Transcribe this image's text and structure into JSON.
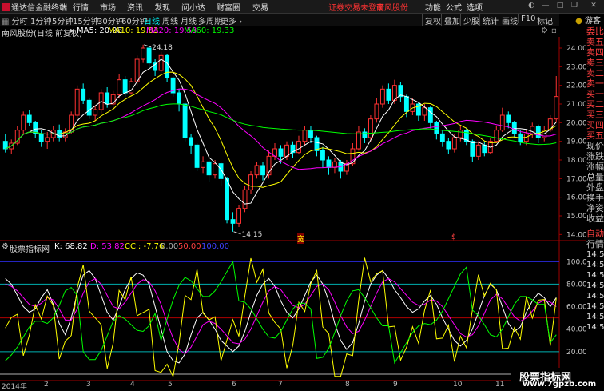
{
  "app": {
    "title": "通达信金融终端"
  },
  "menu": [
    "行情",
    "市场",
    "资讯",
    "发现",
    "问小达",
    "财富圈",
    "交易"
  ],
  "warning": "证券交易未登录",
  "stock_link": "南风股份",
  "right_menu": [
    "功能",
    "公式",
    "选项"
  ],
  "periods": [
    "分时",
    "1分钟",
    "5分钟",
    "15分钟",
    "30分钟",
    "60分钟",
    "日线",
    "周线",
    "月线",
    "多周期",
    "更多"
  ],
  "active_period": "日线",
  "right_tools": [
    "复权",
    "叠加",
    "少股",
    "统计",
    "画线",
    "F10",
    "标记"
  ],
  "guest": "游客",
  "info": {
    "stock": "南风股份(日线 前复权)",
    "ma5": "MA5: 20.28",
    "ma10": "MA10: 19.83",
    "ma20": "MA20: 19.53",
    "ma60": "MA60: 19.33"
  },
  "price_axis": [
    "24.00",
    "23.00",
    "22.00",
    "21.00",
    "20.00",
    "19.00",
    "18.00",
    "17.00",
    "16.00",
    "15.00",
    "14.00"
  ],
  "high_label": "24.18",
  "low_label": "14.15",
  "indicator": {
    "name": "股票指标网",
    "k": "K: 68.82",
    "d": "D: 53.82",
    "cci": "CCI: -7.76",
    "v0": "0.00",
    "v50": "50.00",
    "v100": "100.00"
  },
  "ind_axis": [
    "100.00",
    "80.00",
    "60.00",
    "40.00",
    "20.00"
  ],
  "markers": [
    "宽",
    "$"
  ],
  "dates": [
    "2014年",
    "2",
    "3",
    "4",
    "5",
    "6",
    "7",
    "8",
    "9",
    "10",
    "11"
  ],
  "side_labels": [
    {
      "t": "委比",
      "c": "red"
    },
    {
      "t": "卖五",
      "c": "red"
    },
    {
      "t": "卖四",
      "c": "red"
    },
    {
      "t": "卖三",
      "c": "red"
    },
    {
      "t": "卖二",
      "c": "red"
    },
    {
      "t": "卖一",
      "c": "red"
    },
    {
      "t": "买一",
      "c": "red"
    },
    {
      "t": "买二",
      "c": "red"
    },
    {
      "t": "买三",
      "c": "red"
    },
    {
      "t": "买四",
      "c": "red"
    },
    {
      "t": "买五",
      "c": "red"
    },
    {
      "t": "现价",
      "c": ""
    },
    {
      "t": "涨跌",
      "c": ""
    },
    {
      "t": "涨幅",
      "c": ""
    },
    {
      "t": "总量",
      "c": ""
    },
    {
      "t": "外盘",
      "c": ""
    },
    {
      "t": "换手",
      "c": ""
    },
    {
      "t": "净资",
      "c": ""
    },
    {
      "t": "收益",
      "c": ""
    }
  ],
  "side_bottom": [
    "自动",
    "行情"
  ],
  "side_times": [
    "14:56",
    "14:56",
    "14:56",
    "14:56",
    "14:56",
    "14:56",
    "14:56",
    "14:56"
  ],
  "watermark": {
    "line1": "股票指标网",
    "line2": "www.7gpzb.com"
  },
  "colors": {
    "up": "#ff3232",
    "down": "#00ffff",
    "ma5": "#ffffff",
    "ma10": "#ffff00",
    "ma20": "#ff00ff",
    "ma60": "#00ff00"
  },
  "chart_data": {
    "type": "line",
    "candles": [
      [
        19.0,
        18.6,
        19.4,
        18.4
      ],
      [
        18.6,
        18.9,
        19.1,
        18.3
      ],
      [
        18.9,
        19.6,
        19.8,
        18.8
      ],
      [
        19.6,
        20.4,
        20.6,
        19.4
      ],
      [
        20.4,
        20.0,
        20.7,
        19.8
      ],
      [
        20.0,
        19.4,
        20.1,
        19.2
      ],
      [
        19.4,
        19.0,
        19.6,
        18.7
      ],
      [
        19.0,
        19.2,
        19.5,
        18.6
      ],
      [
        19.2,
        19.6,
        19.8,
        19.0
      ],
      [
        19.6,
        19.2,
        19.9,
        19.0
      ],
      [
        19.2,
        19.5,
        19.7,
        19.0
      ],
      [
        19.5,
        20.4,
        20.6,
        19.4
      ],
      [
        20.4,
        21.8,
        22.0,
        20.2
      ],
      [
        21.8,
        21.2,
        22.1,
        21.0
      ],
      [
        21.2,
        20.4,
        21.3,
        20.2
      ],
      [
        20.4,
        20.7,
        20.9,
        20.1
      ],
      [
        20.7,
        21.6,
        21.8,
        20.5
      ],
      [
        21.6,
        21.0,
        21.9,
        20.8
      ],
      [
        21.0,
        21.5,
        21.7,
        20.7
      ],
      [
        21.5,
        22.3,
        22.6,
        21.3
      ],
      [
        22.3,
        21.6,
        22.5,
        21.4
      ],
      [
        21.6,
        22.2,
        22.4,
        21.5
      ],
      [
        22.2,
        23.4,
        23.6,
        22.0
      ],
      [
        23.4,
        24.0,
        24.18,
        23.2
      ],
      [
        24.0,
        23.2,
        24.1,
        22.9
      ],
      [
        23.2,
        22.8,
        23.4,
        22.5
      ],
      [
        22.8,
        23.6,
        23.8,
        22.7
      ],
      [
        23.6,
        22.4,
        23.7,
        22.2
      ],
      [
        22.4,
        21.6,
        22.5,
        21.4
      ],
      [
        21.6,
        21.0,
        21.8,
        20.6
      ],
      [
        21.0,
        19.2,
        21.1,
        19.0
      ],
      [
        19.2,
        18.8,
        19.4,
        18.3
      ],
      [
        18.8,
        17.6,
        18.9,
        17.4
      ],
      [
        17.6,
        17.9,
        18.2,
        17.3
      ],
      [
        17.9,
        17.2,
        18.0,
        16.8
      ],
      [
        17.2,
        17.8,
        18.0,
        17.0
      ],
      [
        17.8,
        17.0,
        17.9,
        16.6
      ],
      [
        17.0,
        14.8,
        17.1,
        14.6
      ],
      [
        14.8,
        14.6,
        15.2,
        14.15
      ],
      [
        14.6,
        15.4,
        15.6,
        14.4
      ],
      [
        15.4,
        16.4,
        16.6,
        15.2
      ],
      [
        16.4,
        17.2,
        17.4,
        16.2
      ],
      [
        17.2,
        17.7,
        17.9,
        17.0
      ],
      [
        17.7,
        17.2,
        17.9,
        16.9
      ],
      [
        17.2,
        18.2,
        18.5,
        17.0
      ],
      [
        18.2,
        18.6,
        18.9,
        18.0
      ],
      [
        18.6,
        18.2,
        18.8,
        17.8
      ],
      [
        18.2,
        18.8,
        19.0,
        18.0
      ],
      [
        18.8,
        18.4,
        19.0,
        18.1
      ],
      [
        18.4,
        19.0,
        19.3,
        18.3
      ],
      [
        19.0,
        19.6,
        19.8,
        18.8
      ],
      [
        19.6,
        19.2,
        19.8,
        18.9
      ],
      [
        19.2,
        18.5,
        19.3,
        18.2
      ],
      [
        18.5,
        18.0,
        18.7,
        17.6
      ],
      [
        18.0,
        17.6,
        18.2,
        17.2
      ],
      [
        17.6,
        17.9,
        18.1,
        17.3
      ],
      [
        17.9,
        17.4,
        18.0,
        17.0
      ],
      [
        17.4,
        17.8,
        18.0,
        17.2
      ],
      [
        17.8,
        18.6,
        18.9,
        17.7
      ],
      [
        18.6,
        19.5,
        19.8,
        18.5
      ],
      [
        19.5,
        19.2,
        19.7,
        18.9
      ],
      [
        19.2,
        20.2,
        20.4,
        19.0
      ],
      [
        20.2,
        21.0,
        21.3,
        20.0
      ],
      [
        21.0,
        21.8,
        22.0,
        20.8
      ],
      [
        21.8,
        21.2,
        22.1,
        21.0
      ],
      [
        21.2,
        22.0,
        22.3,
        21.0
      ],
      [
        22.0,
        21.4,
        22.2,
        21.1
      ],
      [
        21.4,
        20.6,
        21.5,
        20.3
      ],
      [
        20.6,
        21.0,
        21.3,
        20.4
      ],
      [
        21.0,
        20.4,
        21.1,
        20.1
      ],
      [
        20.4,
        20.8,
        21.0,
        20.1
      ],
      [
        20.8,
        20.0,
        20.9,
        19.7
      ],
      [
        20.0,
        19.4,
        20.1,
        19.1
      ],
      [
        19.4,
        19.0,
        19.6,
        18.7
      ],
      [
        19.0,
        18.6,
        19.2,
        18.3
      ],
      [
        18.6,
        19.2,
        19.4,
        18.4
      ],
      [
        19.2,
        19.6,
        19.8,
        19.0
      ],
      [
        19.6,
        19.0,
        19.7,
        18.8
      ],
      [
        19.0,
        18.2,
        19.1,
        17.9
      ],
      [
        18.2,
        18.8,
        19.0,
        18.0
      ],
      [
        18.8,
        18.4,
        19.0,
        18.2
      ],
      [
        18.4,
        19.0,
        19.2,
        18.3
      ],
      [
        19.0,
        19.6,
        19.8,
        18.9
      ],
      [
        19.6,
        20.4,
        20.8,
        19.5
      ],
      [
        20.4,
        20.0,
        20.6,
        19.7
      ],
      [
        20.0,
        19.4,
        20.1,
        19.2
      ],
      [
        19.4,
        19.0,
        19.6,
        18.8
      ],
      [
        19.0,
        19.4,
        19.6,
        18.8
      ],
      [
        19.4,
        19.8,
        20.0,
        19.2
      ],
      [
        19.8,
        19.2,
        19.9,
        18.9
      ],
      [
        19.2,
        19.6,
        19.8,
        19.0
      ],
      [
        19.6,
        20.2,
        20.4,
        19.5
      ],
      [
        20.2,
        21.4,
        22.5,
        20.0
      ]
    ],
    "k_values": [
      85,
      80,
      70,
      60,
      55,
      58,
      68,
      75,
      62,
      45,
      35,
      50,
      72,
      88,
      92,
      85,
      70,
      55,
      48,
      60,
      75,
      85,
      90,
      88,
      80,
      60,
      40,
      20,
      12,
      10,
      18,
      35,
      50,
      55,
      48,
      40,
      30,
      25,
      20,
      25,
      38,
      55,
      70,
      80,
      85,
      78,
      65,
      55,
      50,
      58,
      70,
      82,
      88,
      80,
      65,
      45,
      30,
      22,
      28,
      45,
      65,
      80,
      88,
      92,
      85,
      75,
      68,
      60,
      55,
      58,
      65,
      70,
      62,
      50,
      40,
      30,
      25,
      30,
      40,
      55,
      70,
      80,
      75,
      60,
      45,
      38,
      42,
      55,
      65,
      72,
      68,
      60,
      68
    ],
    "d_values": [
      80,
      78,
      74,
      68,
      62,
      60,
      63,
      68,
      66,
      58,
      48,
      48,
      58,
      72,
      82,
      85,
      80,
      70,
      60,
      58,
      64,
      72,
      80,
      84,
      82,
      74,
      62,
      46,
      32,
      22,
      18,
      24,
      34,
      44,
      47,
      45,
      40,
      34,
      28,
      27,
      31,
      40,
      52,
      64,
      74,
      78,
      75,
      68,
      61,
      59,
      62,
      70,
      78,
      80,
      75,
      64,
      52,
      42,
      36,
      38,
      48,
      60,
      72,
      82,
      85,
      82,
      76,
      70,
      64,
      61,
      62,
      66,
      65,
      60,
      52,
      44,
      36,
      33,
      35,
      43,
      54,
      66,
      71,
      67,
      59,
      51,
      47,
      50,
      56,
      63,
      66,
      64,
      60
    ]
  }
}
